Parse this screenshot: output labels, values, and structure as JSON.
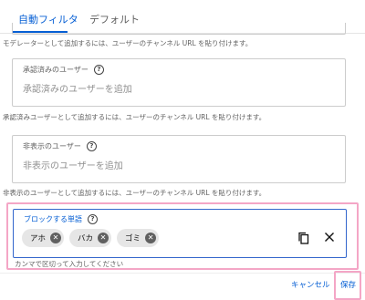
{
  "tabs": [
    {
      "label": "自動フィルタ",
      "active": true
    },
    {
      "label": "デフォルト",
      "active": false
    }
  ],
  "moderators": {
    "helper": "モデレーターとして追加するには、ユーザーのチャンネル URL を貼り付けます。"
  },
  "approved_users": {
    "label": "承認済みのユーザー",
    "placeholder": "承認済みのユーザーを追加",
    "helper": "承認済みユーザーとして追加するには、ユーザーのチャンネル URL を貼り付けます。"
  },
  "hidden_users": {
    "label": "非表示のユーザー",
    "placeholder": "非表示のユーザーを追加",
    "helper": "非表示のユーザーとして追加するには、ユーザーのチャンネル URL を貼り付けます。"
  },
  "blocked_words": {
    "label": "ブロックする単語",
    "chips": [
      "アホ",
      "バカ",
      "ゴミ"
    ],
    "hint": "カンマで区切って入力してください"
  },
  "footer": {
    "cancel_label": "キャンセル",
    "save_label": "保存"
  },
  "colors": {
    "accent": "#065fd4",
    "highlight": "#f4a6c6"
  },
  "icons": {
    "help": "help-circle-icon",
    "chip_remove": "remove-circle-icon",
    "copy": "copy-icon",
    "clear": "close-icon"
  }
}
